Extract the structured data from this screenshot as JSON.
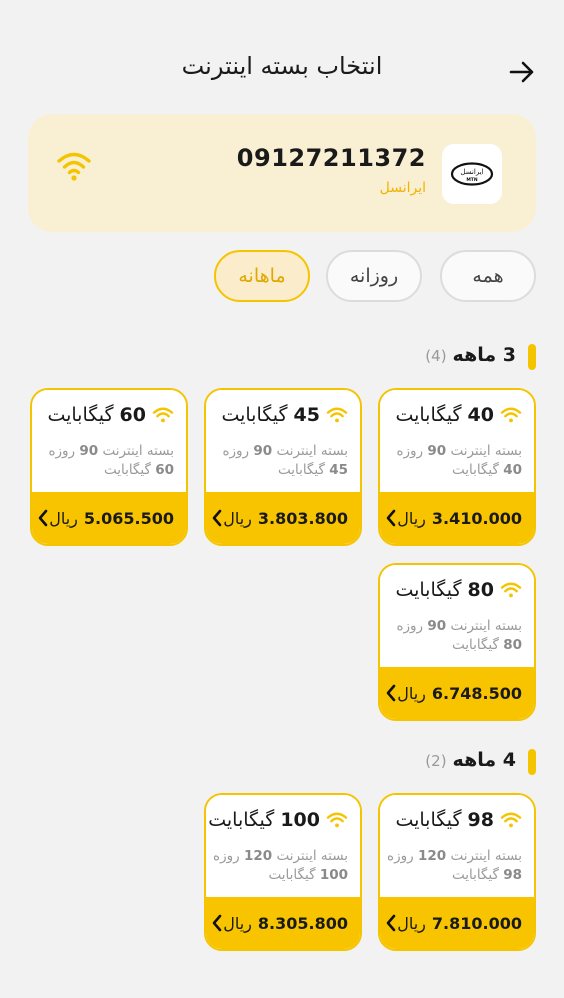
{
  "header": {
    "title": "انتخاب بسته اینترنت"
  },
  "sim": {
    "number": "09127211372",
    "operator_name": "ایرانسل",
    "logo_text_fa": "ایرانسل",
    "logo_text_en": "MTN"
  },
  "filters": [
    {
      "label": "همه",
      "active": false
    },
    {
      "label": "روزانه",
      "active": false
    },
    {
      "label": "ماهانه",
      "active": true
    }
  ],
  "sections": [
    {
      "title": "3 ماهه",
      "count": "(4)",
      "packages": [
        {
          "volume": "40",
          "unit": "گیگابایت",
          "desc_prefix": "بسته اینترنت",
          "days": "90",
          "desc_days": "روزه",
          "desc_volume": "40",
          "desc_unit": "گیگابایت",
          "price": "3.410.000",
          "currency": "ریال"
        },
        {
          "volume": "45",
          "unit": "گیگابایت",
          "desc_prefix": "بسته اینترنت",
          "days": "90",
          "desc_days": "روزه",
          "desc_volume": "45",
          "desc_unit": "گیگابایت",
          "price": "3.803.800",
          "currency": "ریال"
        },
        {
          "volume": "60",
          "unit": "گیگابایت",
          "desc_prefix": "بسته اینترنت",
          "days": "90",
          "desc_days": "روزه",
          "desc_volume": "60",
          "desc_unit": "گیگابایت",
          "price": "5.065.500",
          "currency": "ریال"
        },
        {
          "volume": "80",
          "unit": "گیگابایت",
          "desc_prefix": "بسته اینترنت",
          "days": "90",
          "desc_days": "روزه",
          "desc_volume": "80",
          "desc_unit": "گیگابایت",
          "price": "6.748.500",
          "currency": "ریال"
        }
      ]
    },
    {
      "title": "4 ماهه",
      "count": "(2)",
      "packages": [
        {
          "volume": "98",
          "unit": "گیگابایت",
          "desc_prefix": "بسته اینترنت",
          "days": "120",
          "desc_days": "روزه",
          "desc_volume": "98",
          "desc_unit": "گیگابایت",
          "price": "7.810.000",
          "currency": "ریال"
        },
        {
          "volume": "100",
          "unit": "گیگابایت",
          "desc_prefix": "بسته اینترنت",
          "days": "120",
          "desc_days": "روزه",
          "desc_volume": "100",
          "desc_unit": "گیگابایت",
          "price": "8.305.800",
          "currency": "ریال"
        }
      ]
    }
  ],
  "colors": {
    "accent": "#f8c400",
    "card_bg": "#f9efd3",
    "active_chip": "#fbeccb"
  }
}
